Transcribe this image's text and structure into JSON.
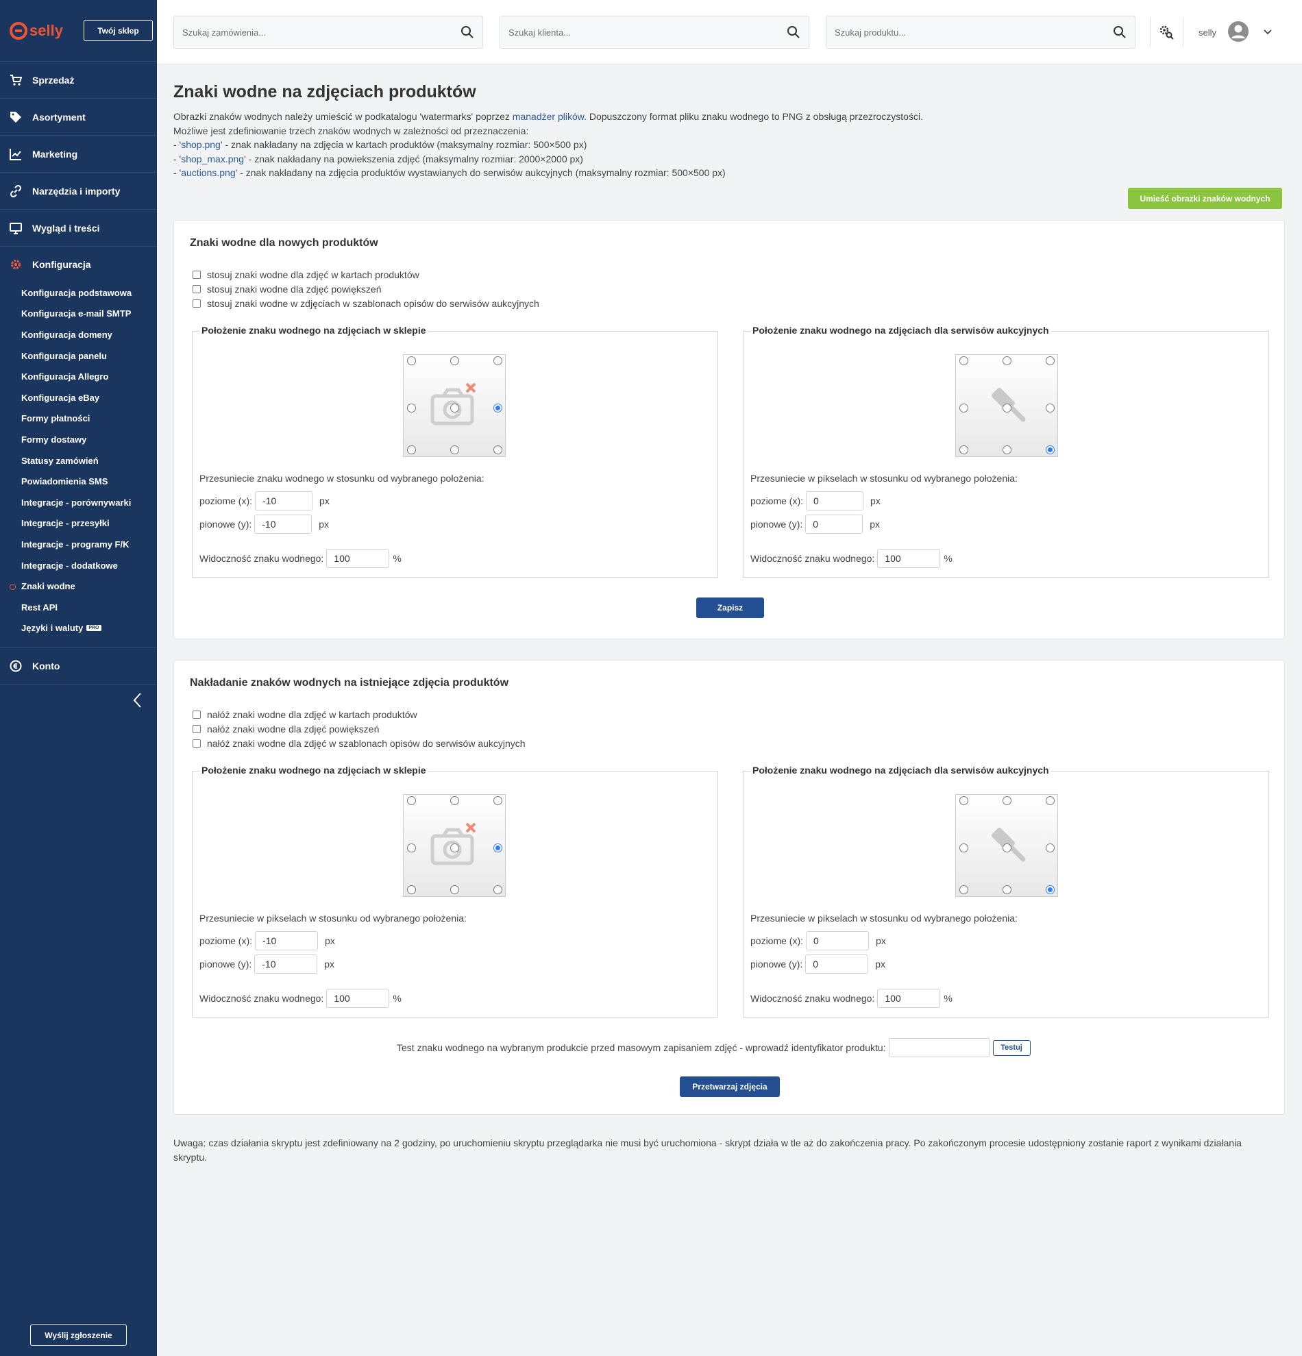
{
  "sidebar": {
    "logo_text": "selly",
    "shop_button": "Twój sklep",
    "nav": [
      {
        "label": "Sprzedaż",
        "icon": "cart-icon"
      },
      {
        "label": "Asortyment",
        "icon": "tag-icon"
      },
      {
        "label": "Marketing",
        "icon": "chart-icon"
      },
      {
        "label": "Narzędzia i importy",
        "icon": "link-icon"
      },
      {
        "label": "Wygląd i treści",
        "icon": "monitor-icon"
      }
    ],
    "active_section": {
      "label": "Konfiguracja",
      "icon": "gear-icon"
    },
    "sub_items": [
      "Konfiguracja podstawowa",
      "Konfiguracja e-mail SMTP",
      "Konfiguracja domeny",
      "Konfiguracja panelu",
      "Konfiguracja Allegro",
      "Konfiguracja eBay",
      "Formy płatności",
      "Formy dostawy",
      "Statusy zamówień",
      "Powiadomienia SMS",
      "Integracje - porównywarki",
      "Integracje - przesyłki",
      "Integracje - programy F/K",
      "Integracje - dodatkowe",
      "Znaki wodne",
      "Rest API",
      "Języki i waluty"
    ],
    "current_sub_item": "Znaki wodne",
    "pro_badge": "PRO",
    "account": {
      "label": "Konto",
      "icon": "account-icon"
    },
    "collapse_icon": "chevron-left-icon",
    "report_button": "Wyślij zgłoszenie"
  },
  "topbar": {
    "search_orders_placeholder": "Szukaj zamówienia...",
    "search_clients_placeholder": "Szukaj klienta...",
    "search_products_placeholder": "Szukaj produktu...",
    "user_name": "selly"
  },
  "page": {
    "title": "Znaki wodne na zdjęciach produktów",
    "desc_line1_pre": "Obrazki znaków wodnych należy umieścić w podkatalogu 'watermarks' poprzez ",
    "desc_line1_link": "manadżer plików",
    "desc_line1_post": ". Dopuszczony format pliku znaku wodnego to PNG z obsługą przezroczystości.",
    "desc_line2": "Możliwe jest zdefiniowanie trzech znaków wodnych w zależności od przeznaczenia:",
    "desc_items": [
      {
        "pre": "- '",
        "link": "shop.png",
        "post": "' - znak nakładany na zdjęcia w kartach produktów (maksymalny rozmiar: 500×500 px)"
      },
      {
        "pre": "- '",
        "link": "shop_max.png",
        "post": "' - znak nakładany na powiekszenia zdjęć (maksymalny rozmiar: 2000×2000 px)"
      },
      {
        "pre": "- '",
        "link": "auctions.png",
        "post": "' - znak nakładany na zdjęcia produktów wystawianych do serwisów aukcyjnych (maksymalny rozmiar: 500×500 px)"
      }
    ],
    "upload_button": "Umieść obrazki znaków wodnych",
    "note": "Uwaga: czas działania skryptu jest zdefiniowany na 2 godziny, po uruchomieniu skryptu przeglądarka nie musi być uruchomiona - skrypt działa w tle aż do zakończenia pracy. Po zakończonym procesie udostępniony zostanie raport z wynikami działania skryptu."
  },
  "panel1": {
    "title": "Znaki wodne dla nowych produktów",
    "checks": [
      "stosuj znaki wodne dla zdjęć w kartach produktów",
      "stosuj znaki wodne dla zdjęć powiększeń",
      "stosuj znaki wodne w zdjęciach w szablonach opisów do serwisów aukcyjnych"
    ],
    "shop": {
      "legend": "Położenie znaku wodnego na zdjęciach w sklepie",
      "offset_label": "Przesuniecie znaku wodnego w stosunku od wybranego położenia:",
      "x_label": "poziome (x):",
      "x_value": "-10",
      "y_label": "pionowe (y):",
      "y_value": "-10",
      "unit": "px",
      "visibility_label": "Widoczność znaku wodnego:",
      "visibility_value": "100",
      "percent": "%",
      "selected_position": "middle-right"
    },
    "auction": {
      "legend": "Położenie znaku wodnego na zdjęciach dla serwisów aukcyjnych",
      "offset_label": "Przesuniecie w pikselach w stosunku od wybranego położenia:",
      "x_label": "poziome (x):",
      "x_value": "0",
      "y_label": "pionowe (y):",
      "y_value": "0",
      "unit": "px",
      "visibility_label": "Widoczność znaku wodnego:",
      "visibility_value": "100",
      "percent": "%",
      "selected_position": "bottom-right"
    },
    "save_button": "Zapisz"
  },
  "panel2": {
    "title": "Nakładanie znaków wodnych na istniejące zdjęcia produktów",
    "checks": [
      "nałóż znaki wodne dla zdjęć w kartach produktów",
      "nałóż znaki wodne dla zdjęć powiększeń",
      "nałóż znaki wodne dla zdjęć w szablonach opisów do serwisów aukcyjnych"
    ],
    "shop": {
      "legend": "Położenie znaku wodnego na zdjęciach w sklepie",
      "offset_label": "Przesuniecie w pikselach w stosunku od wybranego położenia:",
      "x_label": "poziome (x):",
      "x_value": "-10",
      "y_label": "pionowe (y):",
      "y_value": "-10",
      "unit": "px",
      "visibility_label": "Widoczność znaku wodnego:",
      "visibility_value": "100",
      "percent": "%",
      "selected_position": "middle-right"
    },
    "auction": {
      "legend": "Położenie znaku wodnego na zdjęciach dla serwisów aukcyjnych",
      "offset_label": "Przesuniecie w pikselach w stosunku od wybranego położenia:",
      "x_label": "poziome (x):",
      "x_value": "0",
      "y_label": "pionowe (y):",
      "y_value": "0",
      "unit": "px",
      "visibility_label": "Widoczność znaku wodnego:",
      "visibility_value": "100",
      "percent": "%",
      "selected_position": "bottom-right"
    },
    "test_label": "Test znaku wodnego na wybranym produkcie przed masowym zapisaniem zdjęć - wprowadź identyfikator produktu:",
    "test_button": "Testuj",
    "process_button": "Przetwarzaj zdjęcia"
  },
  "colors": {
    "sidebar_bg": "#1a355e",
    "accent_orange": "#ef5533",
    "green_button": "#8bc540",
    "blue_button": "#234f92",
    "radio_selected": "#2f7df4"
  }
}
